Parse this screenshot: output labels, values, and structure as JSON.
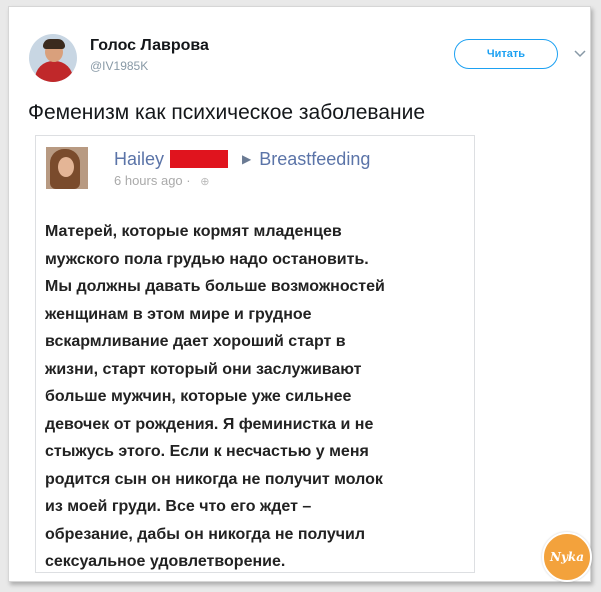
{
  "tweet": {
    "author_name": "Голос Лаврова",
    "author_handle": "@IV1985K",
    "follow_label": "Читать",
    "more_icon": "chevron-down-icon",
    "text": "Феменизм как психическое заболевание"
  },
  "fb_post": {
    "author": "Hailey",
    "group": "Breastfeeding",
    "time": "6 hours ago ·",
    "body_lines": [
      "Матерей, которые кормят младенцев",
      "мужского пола грудью надо остановить.",
      "Мы должны давать больше возможностей",
      "женщинам в этом мире и грудное",
      "вскармливание дает хороший старт в",
      "жизни, старт который они заслуживают",
      "больше мужчин, которые уже сильнее",
      "девочек от рождения. Я феминистка и не",
      "стыжусь этого. Если к несчастью у меня",
      "родится сын он никогда не получит молок",
      "из моей груди. Все что его ждет –",
      "обрезание, дабы он никогда не получил",
      "сексуальное удовлетворение."
    ]
  },
  "watermark": {
    "text": "Nyka"
  },
  "colors": {
    "follow_accent": "#1da1f2",
    "fb_link": "#5b74a8",
    "redaction": "#e0141e",
    "watermark": "#f3a23c"
  }
}
